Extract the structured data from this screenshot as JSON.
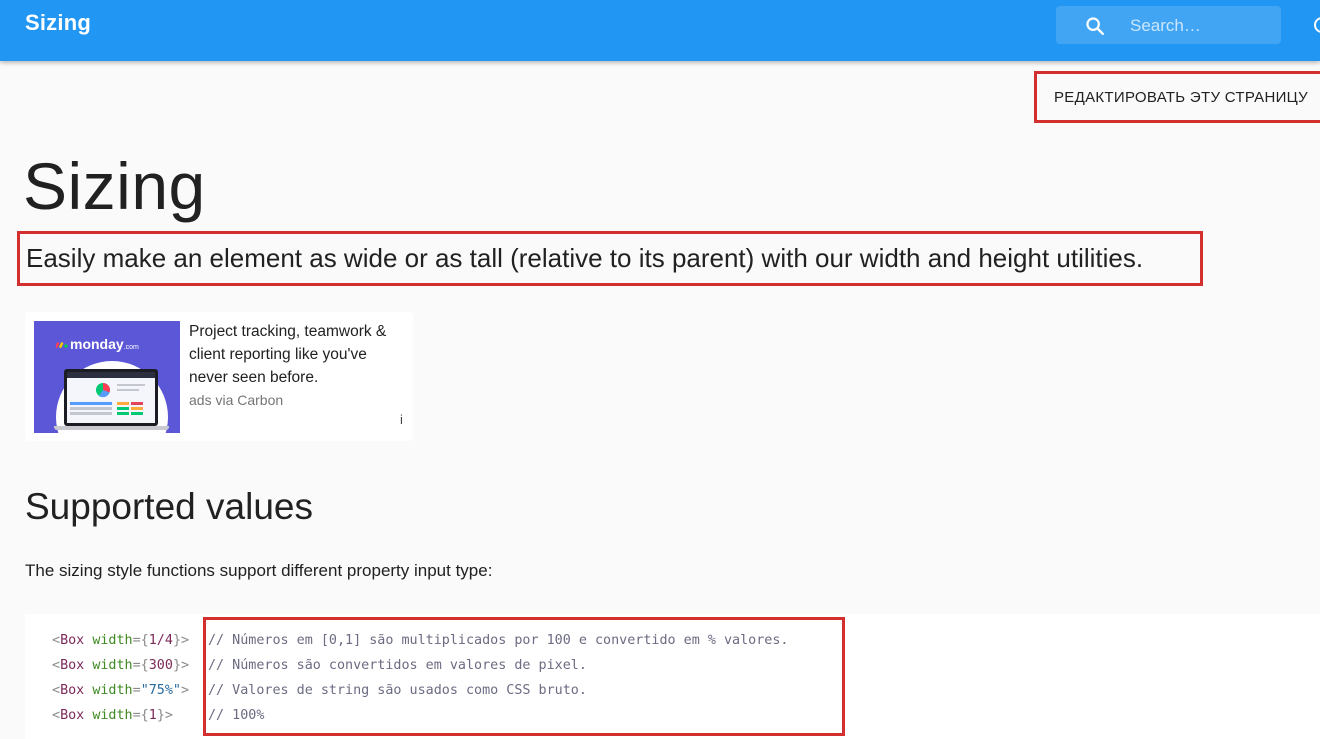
{
  "appbar": {
    "title": "Sizing",
    "search_placeholder": "Search…",
    "color": "#2196f3"
  },
  "edit_link": "РЕДАКТИРОВАТЬ ЭТУ СТРАНИЦУ",
  "page": {
    "title": "Sizing",
    "description": "Easily make an element as wide or as tall (relative to its parent) with our width and height utilities."
  },
  "ad": {
    "brand": "monday",
    "brand_suffix": ".com",
    "text": "Project tracking, teamwork & client reporting like you've never seen before.",
    "via": "ads via Carbon",
    "info": "i"
  },
  "section": {
    "heading": "Supported values",
    "paragraph": "The sizing style functions support different property input type:"
  },
  "code": {
    "lines": [
      {
        "tag": "Box",
        "attr": "width",
        "open": "={",
        "value": "1/4",
        "close": "}>",
        "comment": "// Números em [0,1] são multiplicados por 100 e convertido em % valores."
      },
      {
        "tag": "Box",
        "attr": "width",
        "open": "={",
        "value": "300",
        "close": "}>",
        "comment": "// Números são convertidos em valores de pixel."
      },
      {
        "tag": "Box",
        "attr": "width",
        "open": "=",
        "value": "\"75%\"",
        "close": ">",
        "comment": "// Valores de string são usados como CSS bruto."
      },
      {
        "tag": "Box",
        "attr": "width",
        "open": "={",
        "value": "1",
        "close": "}>",
        "comment": "// 100%"
      }
    ]
  },
  "highlight_color": "#d32f2f"
}
